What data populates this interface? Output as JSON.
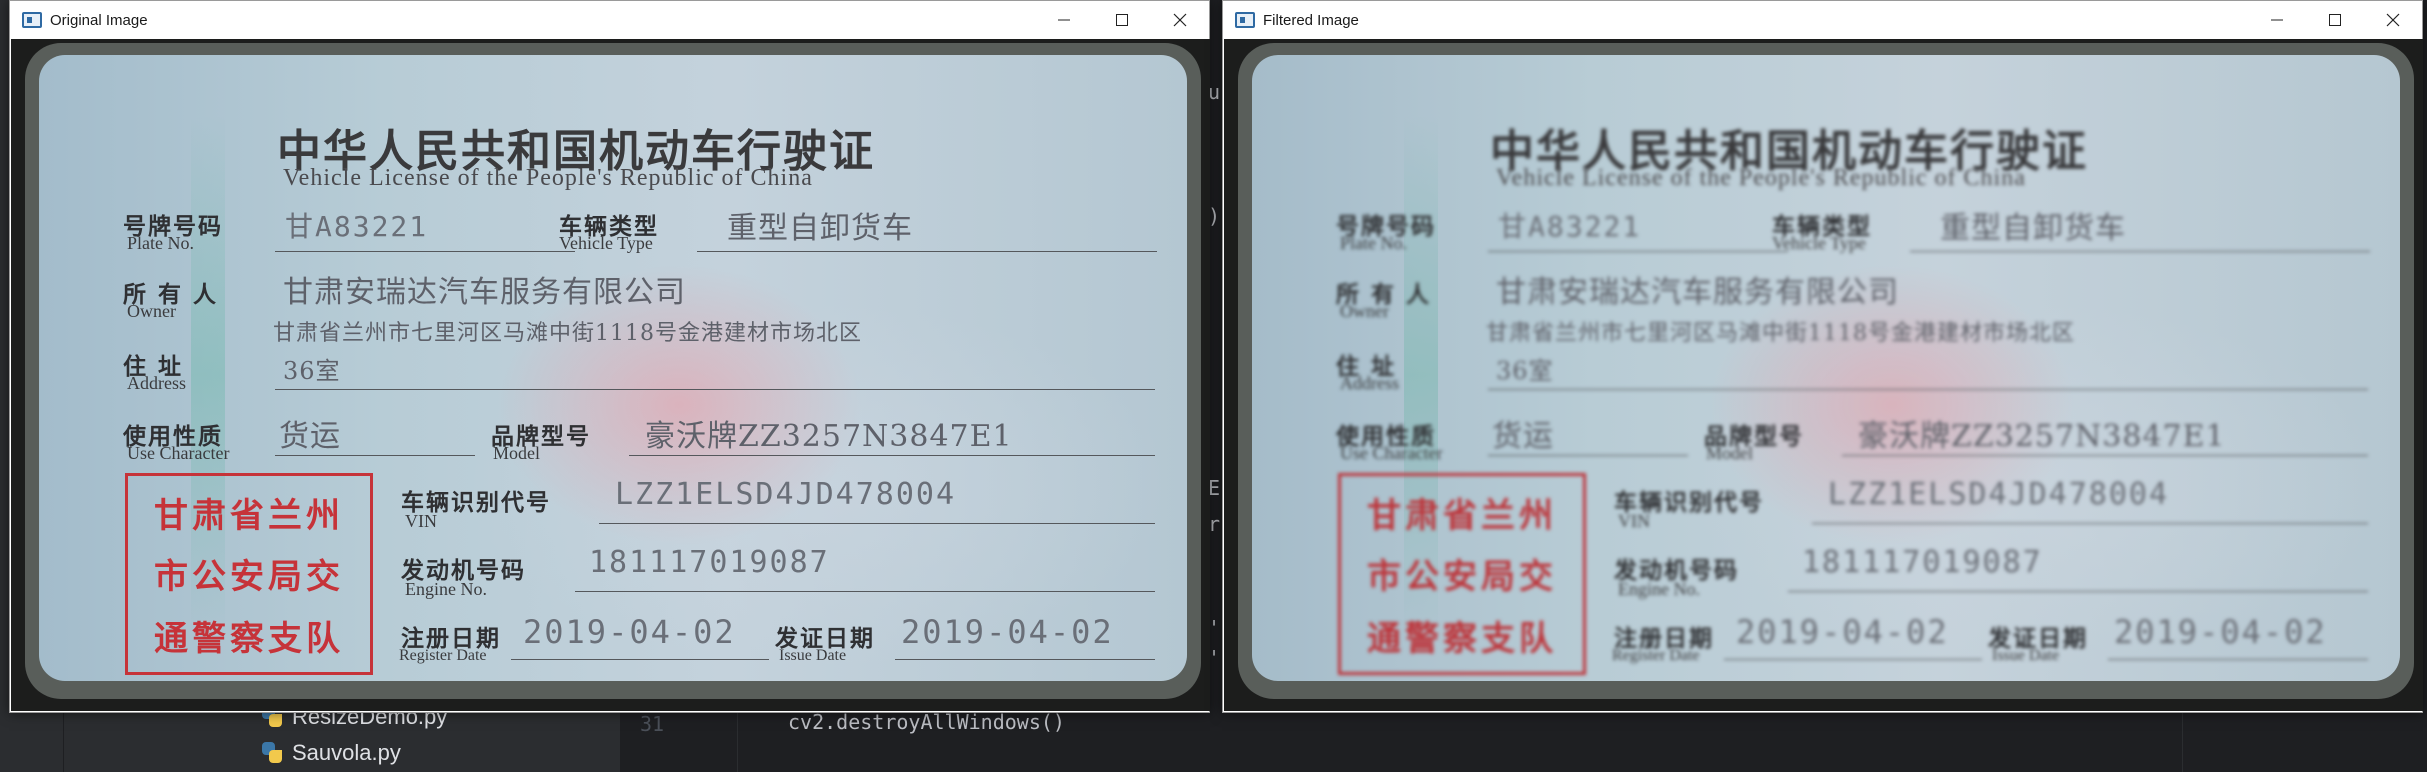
{
  "ide": {
    "files": [
      {
        "name": "ResizeDemo.py"
      },
      {
        "name": "Sauvola.py"
      }
    ],
    "line_number": "31",
    "code_line": "cv2.destroyAllWindows()",
    "fragments": [
      "u",
      ")",
      "E",
      "r",
      "'",
      "'"
    ]
  },
  "windows": [
    {
      "title": "Original Image"
    },
    {
      "title": "Filtered Image"
    }
  ],
  "card": {
    "title_cn": "中华人民共和国机动车行驶证",
    "title_en": "Vehicle License of the People's Republic of China",
    "plate_label_cn": "号牌号码",
    "plate_label_en": "Plate No.",
    "plate_value": "甘A83221",
    "type_label_cn": "车辆类型",
    "type_label_en": "Vehicle Type",
    "type_value": "重型自卸货车",
    "owner_label_cn": "所 有 人",
    "owner_label_en": "Owner",
    "owner_value": "甘肃安瑞达汽车服务有限公司",
    "address_value_1": "甘肃省兰州市七里河区马滩中街1118号金港建材市场北区",
    "address_label_cn": "住 址",
    "address_label_en": "Address",
    "address_value_2": "36室",
    "use_label_cn": "使用性质",
    "use_label_en": "Use Character",
    "use_value": "货运",
    "model_label_cn": "品牌型号",
    "model_label_en": "Model",
    "model_value": "豪沃牌ZZ3257N3847E1",
    "vin_label_cn": "车辆识别代号",
    "vin_label_en": "VIN",
    "vin_value": "LZZ1ELSD4JD478004",
    "engine_label_cn": "发动机号码",
    "engine_label_en": "Engine No.",
    "engine_value": "181117019087",
    "register_label_cn": "注册日期",
    "register_label_en": "Register Date",
    "register_value": "2019-04-02",
    "issue_label_cn": "发证日期",
    "issue_label_en": "Issue Date",
    "issue_value": "2019-04-02",
    "seal_lines": [
      "甘肃省兰州",
      "市公安局交",
      "通警察支队"
    ]
  },
  "colors": {
    "ide_bg": "#1e1f22",
    "ide_panel": "#2b2d30",
    "seal_red": "#c63339",
    "card_blue": "#b7ccd6"
  }
}
